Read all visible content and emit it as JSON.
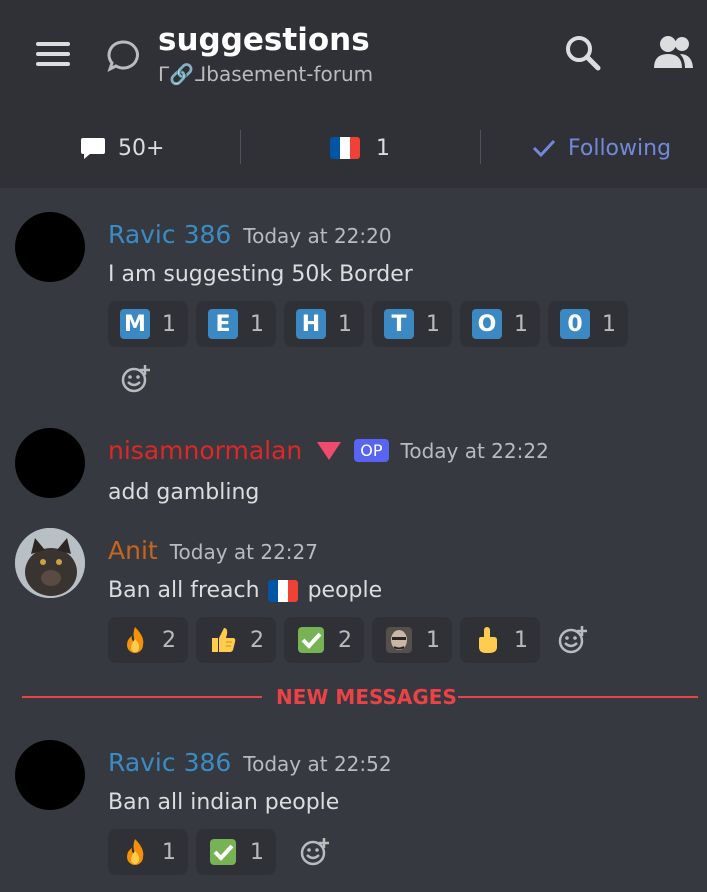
{
  "header": {
    "title": "suggestions",
    "subtitle": "ᒥ🔗ᒧbasement-forum",
    "icons": [
      "hamburger-menu-icon",
      "thread-icon",
      "search-icon",
      "members-icon"
    ]
  },
  "stats": {
    "messages": "50+",
    "participants": "1",
    "follow": "Following",
    "icons": [
      "chat-bubble-icon",
      "french-flag-icon",
      "checkmark-icon"
    ]
  },
  "colors": {
    "background": "#36393f",
    "header_bg": "#2f3136",
    "ravic_name": "#3b8cc4",
    "nisam_name": "#e02727",
    "anit_name": "#c7641f",
    "accent": "#7289da",
    "new_messages": "#ed4245"
  },
  "messages": [
    {
      "author": "Ravic 386",
      "timestamp": "Today at 22:20",
      "text": "I am suggesting 50k Border",
      "reactions": [
        {
          "emoji": "M",
          "count": "1"
        },
        {
          "emoji": "E",
          "count": "1"
        },
        {
          "emoji": "H",
          "count": "1"
        },
        {
          "emoji": "T",
          "count": "1"
        },
        {
          "emoji": "O",
          "count": "1"
        },
        {
          "emoji": "0",
          "count": "1"
        }
      ]
    },
    {
      "author": "nisamnormalan",
      "badge": "OP",
      "timestamp": "Today at 22:22",
      "text": "add gambling"
    },
    {
      "author": "Anit",
      "timestamp": "Today at 22:27",
      "text_before": "Ban all freach",
      "text_after": "people",
      "reactions": [
        {
          "emoji": "fire-icon",
          "count": "2"
        },
        {
          "emoji": "thumbs-up-icon",
          "count": "2"
        },
        {
          "emoji": "check-box-icon",
          "count": "2"
        },
        {
          "emoji": "face-emoji-icon",
          "count": "1"
        },
        {
          "emoji": "middle-finger-icon",
          "count": "1"
        }
      ]
    },
    {
      "author": "Ravic 386",
      "timestamp": "Today at 22:52",
      "text": "Ban all indian people",
      "reactions": [
        {
          "emoji": "fire-icon",
          "count": "1"
        },
        {
          "emoji": "check-box-icon",
          "count": "1"
        }
      ]
    }
  ],
  "divider": {
    "label": "NEW MESSAGES"
  }
}
